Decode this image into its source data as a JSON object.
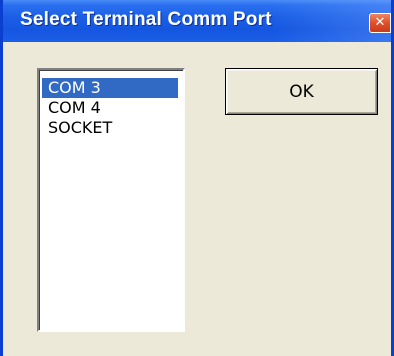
{
  "window": {
    "title": "Select Terminal Comm Port",
    "close_icon": "close-x-icon"
  },
  "port_list": {
    "items": [
      {
        "label": "COM 3",
        "selected": true
      },
      {
        "label": "COM 4",
        "selected": false
      },
      {
        "label": "SOCKET",
        "selected": false
      }
    ]
  },
  "buttons": {
    "ok_label": "OK"
  },
  "colors": {
    "titlebar": "#1c5fe6",
    "dialog_background": "#ece9d8",
    "selection": "#316ac5",
    "close_button": "#e0502a"
  }
}
